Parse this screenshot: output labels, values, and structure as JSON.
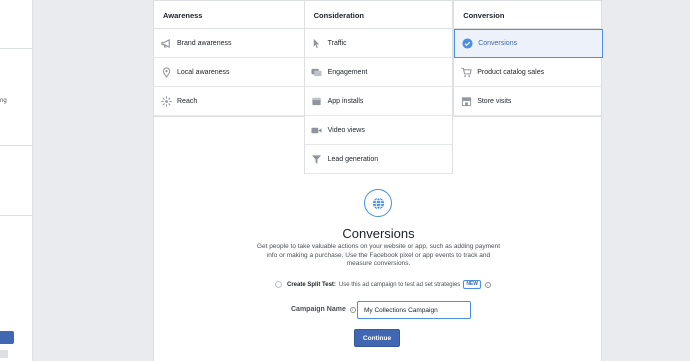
{
  "left_panel": {
    "sliver_text": "ng"
  },
  "columns": [
    {
      "id": "awareness",
      "heading": "Awareness",
      "items": [
        {
          "label": "Brand awareness",
          "icon": "megaphone-icon"
        },
        {
          "label": "Local awareness",
          "icon": "location-pin-icon"
        },
        {
          "label": "Reach",
          "icon": "reach-burst-icon"
        }
      ]
    },
    {
      "id": "consideration",
      "heading": "Consideration",
      "items": [
        {
          "label": "Traffic",
          "icon": "cursor-icon"
        },
        {
          "label": "Engagement",
          "icon": "chat-bubbles-icon"
        },
        {
          "label": "App installs",
          "icon": "box-icon"
        },
        {
          "label": "Video views",
          "icon": "video-camera-icon"
        },
        {
          "label": "Lead generation",
          "icon": "funnel-icon"
        }
      ]
    },
    {
      "id": "conversion",
      "heading": "Conversion",
      "items": [
        {
          "label": "Conversions",
          "icon": "globe-icon",
          "selected": true
        },
        {
          "label": "Product catalog sales",
          "icon": "cart-icon"
        },
        {
          "label": "Store visits",
          "icon": "store-icon"
        }
      ]
    }
  ],
  "detail": {
    "title": "Conversions",
    "description": "Get people to take valuable actions on your website or app, such as adding payment info or making a purchase. Use the Facebook pixel or app events to track and measure conversions."
  },
  "split_test": {
    "label": "Create Split Test:",
    "text": "Use this ad campaign to test ad set strategies",
    "badge": "NEW"
  },
  "campaign_name": {
    "label": "Campaign Name",
    "value": "My Collections Campaign"
  },
  "continue_label": "Continue",
  "colors": {
    "accent": "#4267b2",
    "selected_border": "#4a90e2",
    "selected_bg": "#edf2fa",
    "page_bg": "#e9ebee"
  }
}
